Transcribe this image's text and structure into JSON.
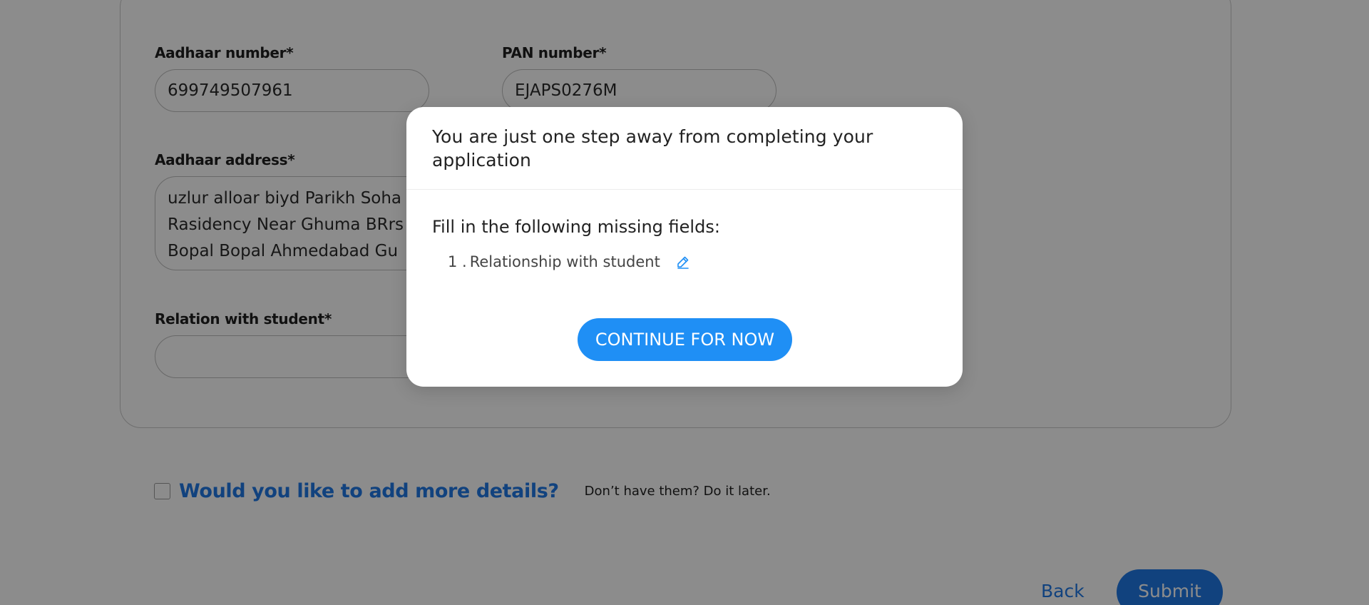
{
  "form": {
    "aadhaar_number": {
      "label": "Aadhaar number*",
      "value": "699749507961"
    },
    "pan_number": {
      "label": "PAN number*",
      "value": "EJAPS0276M"
    },
    "aadhaar_address": {
      "label": "Aadhaar address*",
      "lines": [
        "uzlur alloar biyd Parikh Soha",
        "Rasidency Near Ghuma BRrs",
        "Bopal Bopal Ahmedabad Gu"
      ]
    },
    "relation_with_student": {
      "label": "Relation with student*",
      "value": ""
    }
  },
  "more_details": {
    "title": "Would you like to add more details?",
    "hint": "Don’t have them? Do it later."
  },
  "actions": {
    "back_label": "Back",
    "submit_label": "Submit"
  },
  "modal": {
    "title": "You are just one step away from completing your application",
    "subtitle": "Fill in the following missing fields:",
    "missing_fields": [
      {
        "number": "1 .",
        "label": "Relationship with student",
        "icon": "pencil-edit-icon"
      }
    ],
    "continue_label": "CONTINUE FOR NOW"
  },
  "colors": {
    "accent": "#1f78e6",
    "button": "#1f8ff5",
    "overlay": "rgba(0,0,0,0.45)"
  }
}
